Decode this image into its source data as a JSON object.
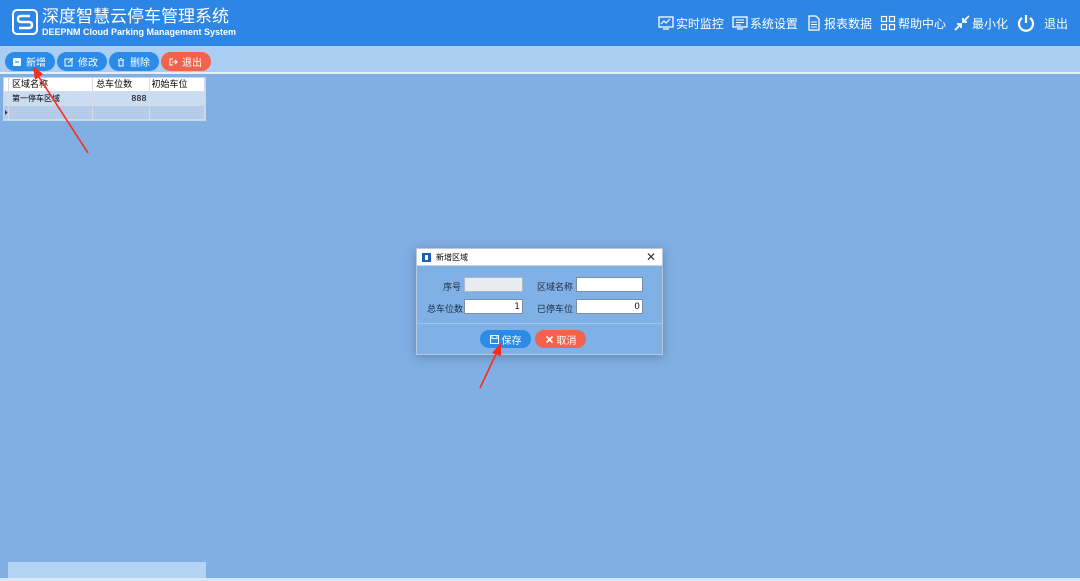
{
  "header": {
    "title": "深度智慧云停车管理系统",
    "subtitle": "DEEPNM Cloud Parking Management System",
    "nav": [
      {
        "label": "实时监控",
        "icon": "monitor-icon"
      },
      {
        "label": "系统设置",
        "icon": "settings-screen-icon"
      },
      {
        "label": "报表数据",
        "icon": "report-icon"
      },
      {
        "label": "帮助中心",
        "icon": "grid-icon"
      },
      {
        "label": "最小化",
        "icon": "minimize-icon"
      },
      {
        "label": "退出",
        "icon": "power-icon"
      }
    ]
  },
  "toolbar": {
    "add_label": "新增",
    "edit_label": "修改",
    "delete_label": "删除",
    "exit_label": "退出"
  },
  "grid": {
    "columns": [
      "区域名称",
      "总车位数",
      "初始车位"
    ],
    "rows": [
      {
        "name": "第一停车区域",
        "total": "888",
        "initial": ""
      }
    ]
  },
  "dialog": {
    "title": "新增区域",
    "close_glyph": "✕",
    "seq_label": "序号",
    "seq_value": "",
    "area_name_label": "区域名称",
    "area_name_value": "",
    "total_label": "总车位数",
    "total_value": "1",
    "parked_label": "已停车位",
    "parked_value": "0",
    "save_label": "保存",
    "cancel_label": "取消"
  },
  "colors": {
    "header_bg": "#2d86e6",
    "workspace_bg": "#80afe4",
    "button_blue": "#2b8be8",
    "button_red": "#f3624c",
    "annotation_arrow": "#ff2a1a"
  }
}
